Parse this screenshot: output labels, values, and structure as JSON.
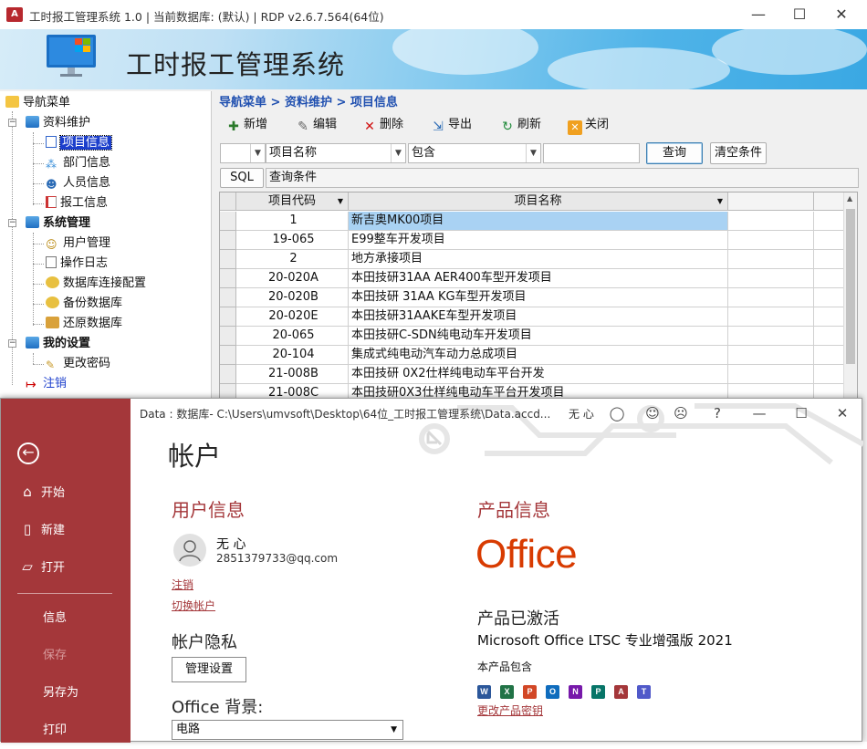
{
  "app": {
    "window_title": "工时报工管理系统 1.0 | 当前数据库: (默认) | RDP v2.6.7.564(64位)",
    "banner_title": "工时报工管理系统",
    "icon_letter": "A"
  },
  "window_controls": {
    "minimize": "—",
    "maximize": "☐",
    "close": "✕"
  },
  "nav": {
    "root": "导航菜单",
    "groups": [
      {
        "label": "资料维护",
        "items": [
          "项目信息",
          "部门信息",
          "人员信息",
          "报工信息"
        ]
      },
      {
        "label": "系统管理",
        "items": [
          "用户管理",
          "操作日志",
          "数据库连接配置",
          "备份数据库",
          "还原数据库"
        ]
      },
      {
        "label": "我的设置",
        "items": [
          "更改密码"
        ]
      }
    ],
    "logout": "注销",
    "selected": "项目信息"
  },
  "main": {
    "breadcrumb": "导航菜单 > 资料维护 > 项目信息",
    "toolbar": {
      "add": "新增",
      "edit": "编辑",
      "delete": "删除",
      "export": "导出",
      "refresh": "刷新",
      "close": "关闭"
    },
    "filter": {
      "field": "项目名称",
      "operator": "包含",
      "value": "",
      "query_button": "查询",
      "clear_button": "清空条件",
      "sql_button": "SQL",
      "sql_label": "查询条件"
    },
    "grid": {
      "columns": [
        "项目代码",
        "项目名称"
      ],
      "rows": [
        [
          "1",
          "新吉奥MK00项目"
        ],
        [
          "19-065",
          "E99整车开发项目"
        ],
        [
          "2",
          "地方承接项目"
        ],
        [
          "20-020A",
          "本田技研31AA AER400车型开发项目"
        ],
        [
          "20-020B",
          "本田技研 31AA KG车型开发项目"
        ],
        [
          "20-020E",
          "本田技研31AAKE车型开发项目"
        ],
        [
          "20-065",
          "本田技研C-SDN纯电动车开发项目"
        ],
        [
          "20-104",
          "集成式纯电动汽车动力总成项目"
        ],
        [
          "21-008B",
          "本田技研 0X2仕样纯电动车平台开发"
        ],
        [
          "21-008C",
          "本田技研0X3仕样纯电动车平台开发项目"
        ]
      ]
    }
  },
  "office": {
    "title": "Data : 数据库- C:\\Users\\umvsoft\\Desktop\\64位_工时报工管理系统\\Data.accd...",
    "username_top": "无 心",
    "help": "?",
    "backstage": {
      "items": [
        "开始",
        "新建",
        "打开",
        "信息",
        "保存",
        "另存为",
        "打印"
      ]
    },
    "page_title": "帐户",
    "user_info_heading": "用户信息",
    "user_name": "无 心",
    "user_email": "2851379733@qq.com",
    "sign_out": "注销",
    "switch_account": "切换帐户",
    "privacy_heading": "帐户隐私",
    "manage_settings": "管理设置",
    "background_heading": "Office 背景:",
    "background_value": "电路",
    "product_heading": "产品信息",
    "office_logo": "Office",
    "activated": "产品已激活",
    "product_name": "Microsoft Office LTSC 专业增强版 2021",
    "includes": "本产品包含",
    "change_key": "更改产品密钥",
    "apps": [
      {
        "letter": "W",
        "color": "#2b579a"
      },
      {
        "letter": "X",
        "color": "#217346"
      },
      {
        "letter": "P",
        "color": "#d24726"
      },
      {
        "letter": "O",
        "color": "#0f6cbd"
      },
      {
        "letter": "N",
        "color": "#7719aa"
      },
      {
        "letter": "P",
        "color": "#077568"
      },
      {
        "letter": "A",
        "color": "#a4373a"
      },
      {
        "letter": "T",
        "color": "#5059c9"
      }
    ]
  }
}
